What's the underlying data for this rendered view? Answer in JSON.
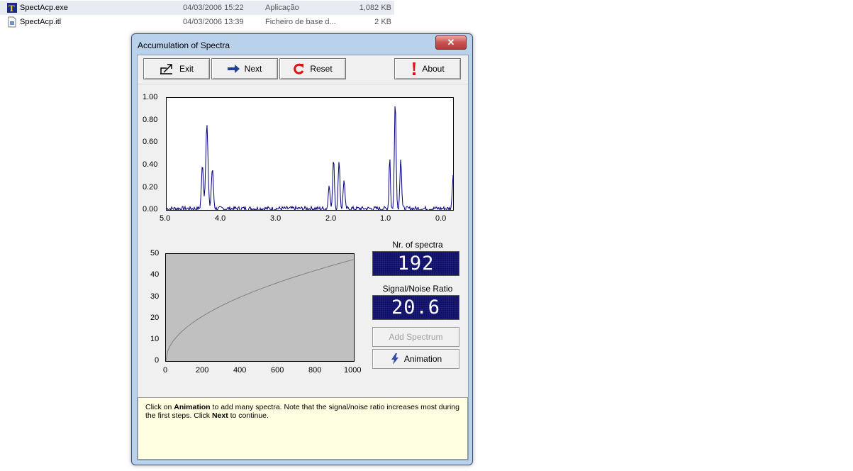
{
  "explorer": {
    "files": [
      {
        "name": "SpectAcp.exe",
        "date": "04/03/2006 15:22",
        "type": "Aplicação",
        "size": "1,082 KB",
        "icon": "app-icon"
      },
      {
        "name": "SpectAcp.itl",
        "date": "04/03/2006 13:39",
        "type": "Ficheiro de base d...",
        "size": "2 KB",
        "icon": "file-icon"
      }
    ]
  },
  "window": {
    "title": "Accumulation of Spectra",
    "close_label": "✕"
  },
  "toolbar": {
    "exit": "Exit",
    "next": "Next",
    "reset": "Reset",
    "about": "About"
  },
  "spectrum": {
    "y_ticks": [
      "1.00",
      "0.80",
      "0.60",
      "0.40",
      "0.20",
      "0.00"
    ],
    "x_ticks": [
      "5.0",
      "4.0",
      "3.0",
      "2.0",
      "1.0",
      "0.0"
    ],
    "line_color": "#000080"
  },
  "sn_chart": {
    "y_ticks": [
      "50",
      "40",
      "30",
      "20",
      "10",
      "0"
    ],
    "x_ticks": [
      "0",
      "200",
      "400",
      "600",
      "800",
      "1000"
    ]
  },
  "counters": {
    "spectra_label": "Nr. of spectra",
    "spectra_value": "192",
    "snr_label": "Signal/Noise Ratio",
    "snr_value": "20.6"
  },
  "buttons": {
    "add_spectrum": "Add Spectrum",
    "animation": "Animation"
  },
  "info": {
    "t1": "Click on ",
    "b1": "Animation",
    "t2": " to add many spectra. Note that the signal/noise ratio increases most during the first steps. Click ",
    "b2": "Next",
    "t3": " to continue."
  }
}
